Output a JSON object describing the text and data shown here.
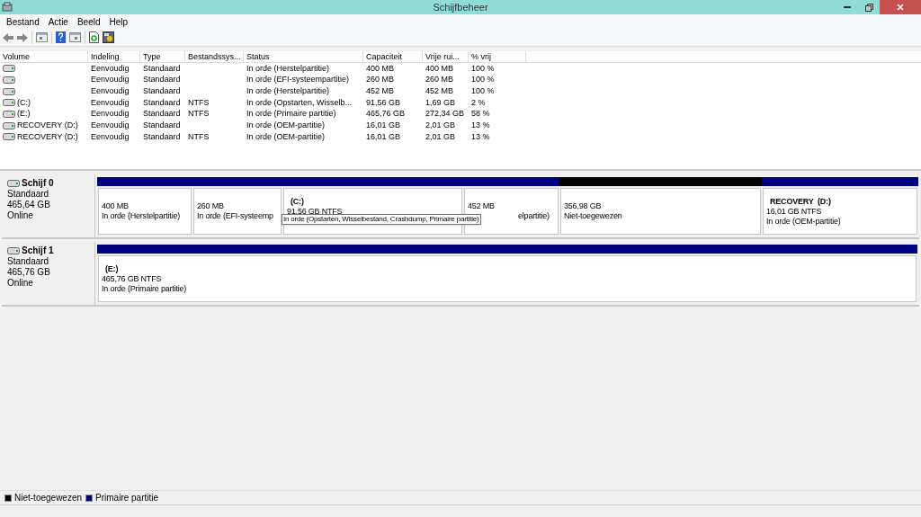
{
  "window": {
    "title": "Schijfbeheer"
  },
  "menu": [
    "Bestand",
    "Actie",
    "Beeld",
    "Help"
  ],
  "table": {
    "columns": [
      "Volume",
      "Indeling",
      "Type",
      "Bestandssys...",
      "Status",
      "Capaciteit",
      "Vrije rui...",
      "% vrij"
    ],
    "rows": [
      {
        "cells": [
          "",
          "Eenvoudig",
          "Standaard",
          "",
          "In orde (Herstelpartitie)",
          "400 MB",
          "400 MB",
          "100 %"
        ]
      },
      {
        "cells": [
          "",
          "Eenvoudig",
          "Standaard",
          "",
          "In orde (EFI-systeempartitie)",
          "260 MB",
          "260 MB",
          "100 %"
        ]
      },
      {
        "cells": [
          "",
          "Eenvoudig",
          "Standaard",
          "",
          "In orde (Herstelpartitie)",
          "452 MB",
          "452 MB",
          "100 %"
        ]
      },
      {
        "cells": [
          "(C:)",
          "Eenvoudig",
          "Standaard",
          "NTFS",
          "In orde (Opstarten, Wisselb...",
          "91,56 GB",
          "1,69 GB",
          "2 %"
        ]
      },
      {
        "cells": [
          "(E:)",
          "Eenvoudig",
          "Standaard",
          "NTFS",
          "In orde (Primaire partitie)",
          "465,76 GB",
          "272,34 GB",
          "58 %"
        ]
      },
      {
        "cells": [
          "RECOVERY (D:)",
          "Eenvoudig",
          "Standaard",
          "",
          "In orde (OEM-partitie)",
          "16,01 GB",
          "2,01 GB",
          "13 %"
        ]
      },
      {
        "cells": [
          "RECOVERY (D:)",
          "Eenvoudig",
          "Standaard",
          "NTFS",
          "In orde (OEM-partitie)",
          "16,01 GB",
          "2,01 GB",
          "13 %"
        ]
      }
    ]
  },
  "disks": [
    {
      "name": "Schijf 0",
      "type": "Standaard",
      "size": "465,64 GB",
      "state": "Online",
      "partitions": [
        {
          "size": "400 MB",
          "status": "In orde (Herstelpartitie)",
          "color": "#000080"
        },
        {
          "size": "260 MB",
          "status": "In orde (EFI-systeemp",
          "color": "#000080"
        },
        {
          "name": "(C:)",
          "size": "91,56 GB NTFS",
          "color": "#000080",
          "tooltip": "In orde (Opstarten, Wisselbestand, Crashdump, Primaire partitie)"
        },
        {
          "size": "452 MB",
          "status": "elpartitie)",
          "color": "#000080",
          "covered": true
        },
        {
          "size": "356,98 GB",
          "status": "Niet-toegewezen",
          "color": "#000000"
        },
        {
          "name": "RECOVERY  (D:)",
          "size": "16,01 GB NTFS",
          "status": "In orde (OEM-partitie)",
          "color": "#000080"
        }
      ]
    },
    {
      "name": "Schijf 1",
      "type": "Standaard",
      "size": "465,76 GB",
      "state": "Online",
      "partitions": [
        {
          "name": "(E:)",
          "size": "465,76 GB NTFS",
          "status": "In orde (Primaire partitie)",
          "color": "#000080"
        }
      ]
    }
  ],
  "legend": [
    {
      "label": "Niet-toegewezen",
      "color": "#000000"
    },
    {
      "label": "Primaire partitie",
      "color": "#000080"
    }
  ]
}
